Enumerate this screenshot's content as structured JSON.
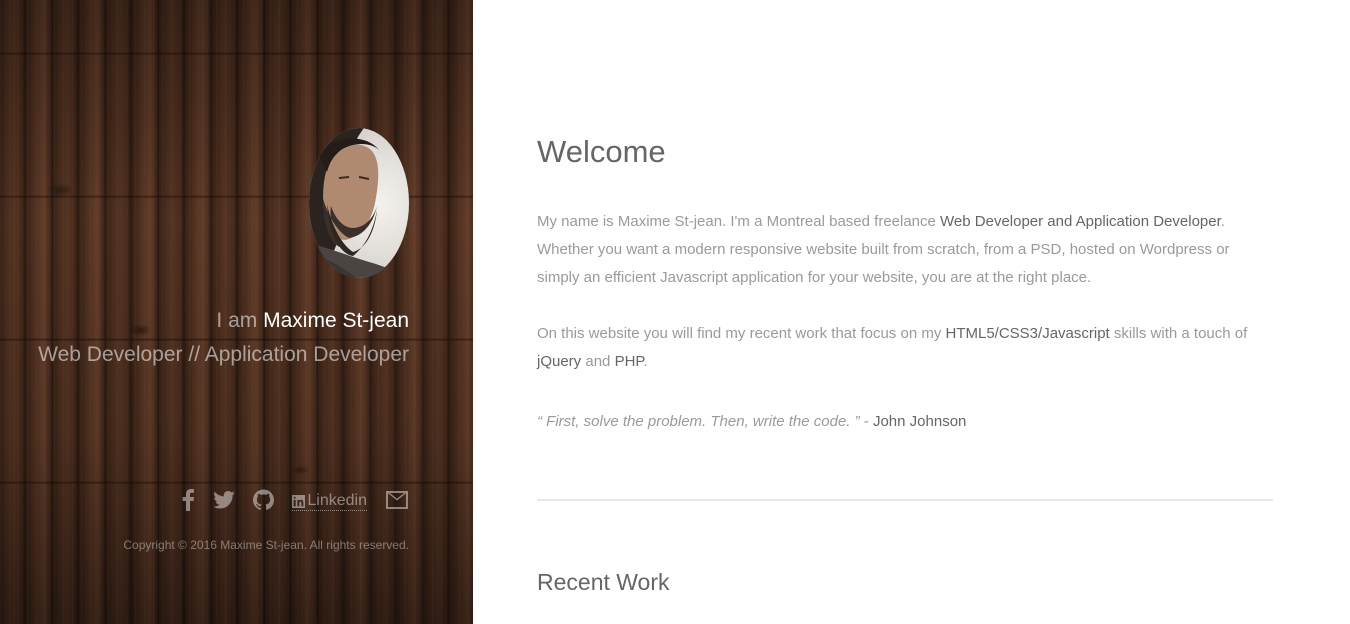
{
  "sidebar": {
    "intro_prefix": "I am",
    "name": "Maxime St-jean",
    "role": "Web Developer // Application Developer",
    "socials": {
      "facebook_icon": "facebook-icon",
      "twitter_icon": "twitter-icon",
      "github_icon": "github-icon",
      "linkedin_label": "Linkedin",
      "email_icon": "envelope-icon"
    },
    "copyright": "Copyright © 2016 Maxime St-jean. All rights reserved."
  },
  "main": {
    "title": "Welcome",
    "p1": {
      "t1": "My name is Maxime St-jean. I'm a Montreal based freelance ",
      "h1": "Web Developer and Application Developer",
      "t2": ". Whether you want a modern responsive website built from scratch, from a PSD, hosted on Wordpress or simply an efficient Javascript application for your website, you are at the right place."
    },
    "p2": {
      "t1": "On this website you will find my recent work that focus on my ",
      "h1": "HTML5/CSS3/Javascript",
      "t2": " skills with a touch of ",
      "h2": "jQuery",
      "t3": " and ",
      "h3": "PHP",
      "t4": "."
    },
    "quote": {
      "text": "“ First, solve the problem. Then, write the code. ”",
      "separator": " - ",
      "author": "John Johnson"
    },
    "recent_title": "Recent Work"
  },
  "colors": {
    "heading": "#666666",
    "body_text": "#9a9a9a",
    "divider": "#e8e8e8"
  }
}
